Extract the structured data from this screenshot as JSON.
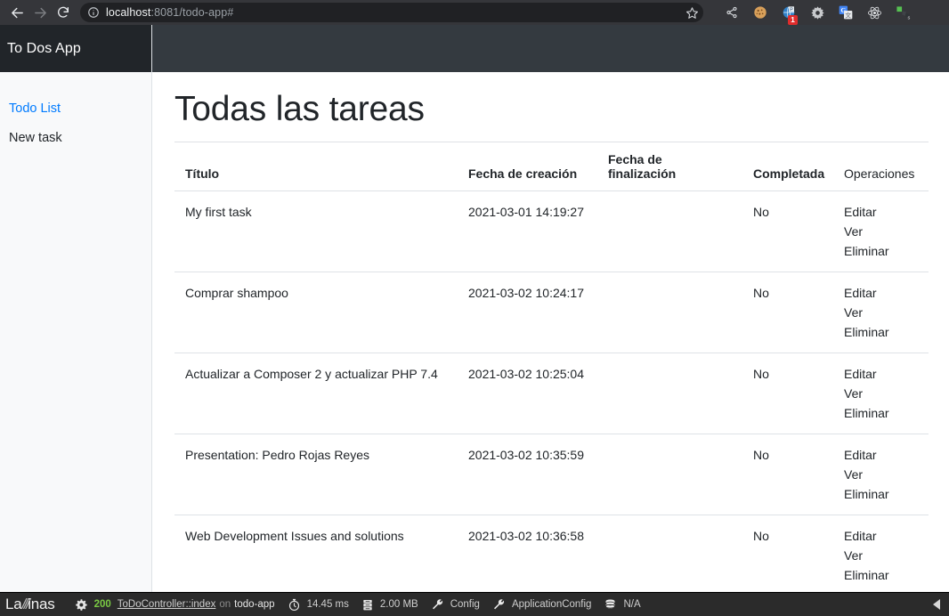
{
  "browser": {
    "back_icon": "arrow-left-icon",
    "forward_icon": "arrow-right-icon",
    "reload_icon": "reload-icon",
    "site_info_icon": "info-circle-icon",
    "url_host": "localhost",
    "url_rest": ":8081/todo-app#",
    "bookmark_icon": "star-icon",
    "extensions": [
      {
        "name": "share-icon",
        "label": "Share"
      },
      {
        "name": "cookie-icon",
        "label": "Cookie Editor"
      },
      {
        "name": "globe-extension-icon",
        "label": "Extension",
        "badge": "1"
      },
      {
        "name": "bug-gear-icon",
        "label": "Debug"
      },
      {
        "name": "google-translate-icon",
        "label": "Google Translate"
      },
      {
        "name": "react-devtools-icon",
        "label": "React Developer Tools"
      },
      {
        "name": "green-puzzle-icon",
        "label": "Extension S"
      }
    ]
  },
  "sidebar": {
    "brand": "To Dos App",
    "items": [
      {
        "label": "Todo List",
        "active": true
      },
      {
        "label": "New task",
        "active": false
      }
    ]
  },
  "main": {
    "title": "Todas las tareas",
    "table": {
      "columns": [
        "Título",
        "Fecha de creación",
        "Fecha de finalización",
        "Completada",
        "Operaciones"
      ],
      "operations": [
        "Editar",
        "Ver",
        "Eliminar"
      ],
      "rows": [
        {
          "title": "My first task",
          "created": "2021-03-01 14:19:27",
          "finished": "",
          "completed": "No"
        },
        {
          "title": "Comprar shampoo",
          "created": "2021-03-02 10:24:17",
          "finished": "",
          "completed": "No"
        },
        {
          "title": "Actualizar a Composer 2 y actualizar PHP 7.4",
          "created": "2021-03-02 10:25:04",
          "finished": "",
          "completed": "No"
        },
        {
          "title": "Presentation: Pedro Rojas Reyes",
          "created": "2021-03-02 10:35:59",
          "finished": "",
          "completed": "No"
        },
        {
          "title": "Web Development Issues and solutions",
          "created": "2021-03-02 10:36:58",
          "finished": "",
          "completed": "No"
        }
      ]
    }
  },
  "devbar": {
    "logo_pre": "La",
    "logo_slashes": "///",
    "logo_post": "inas",
    "status_code": "200",
    "route": "ToDoController::index",
    "route_on": "on",
    "route_app": "todo-app",
    "time": "14.45 ms",
    "memory": "2.00 MB",
    "config": "Config",
    "application_config": "ApplicationConfig",
    "database": "N/A",
    "icons": {
      "gear": "gear-icon",
      "timer": "stopwatch-icon",
      "memory": "memory-icon",
      "wrench": "wrench-icon",
      "database": "database-icon",
      "collapse": "collapse-left-icon"
    }
  }
}
